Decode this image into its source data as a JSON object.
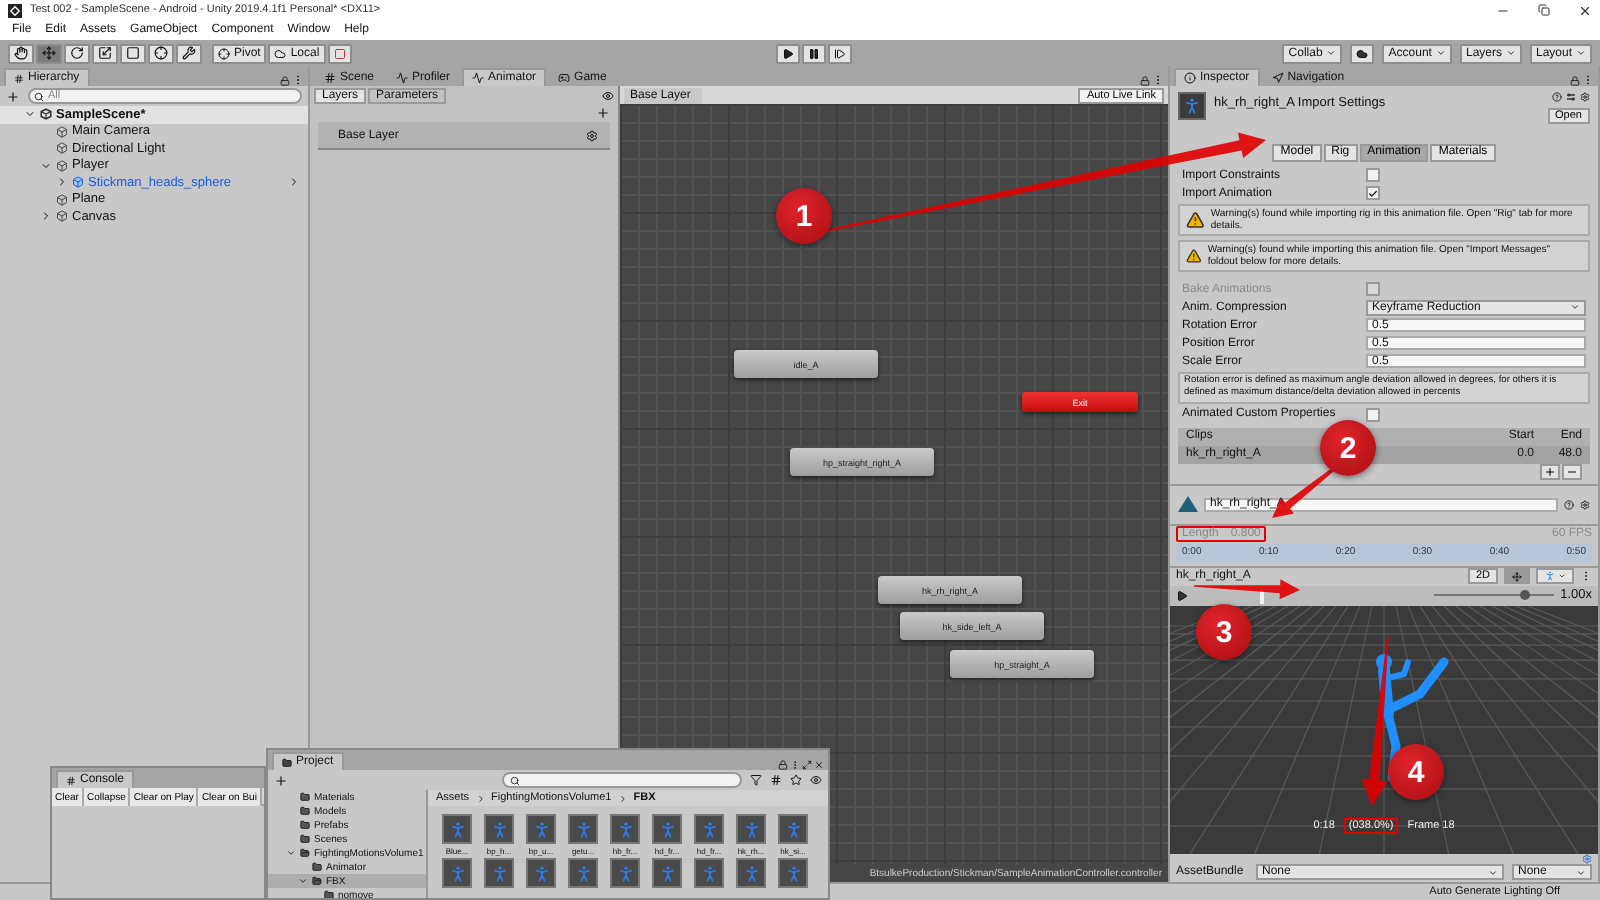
{
  "window": {
    "title": "Test 002 - SampleScene - Android - Unity 2019.4.1f1 Personal* <DX11>"
  },
  "menu": [
    "File",
    "Edit",
    "Assets",
    "GameObject",
    "Component",
    "Window",
    "Help"
  ],
  "toolbar": {
    "tools": [
      {
        "kind": "hand",
        "selected": false
      },
      {
        "kind": "move",
        "selected": true
      },
      {
        "kind": "rotate",
        "selected": false
      },
      {
        "kind": "scale",
        "selected": false
      },
      {
        "kind": "rect",
        "selected": false
      },
      {
        "kind": "transform",
        "selected": false
      },
      {
        "kind": "custom",
        "selected": false
      }
    ],
    "pivot": "Pivot",
    "space": "Local",
    "menus": [
      {
        "kind": "dropdown",
        "label": "Collab"
      },
      {
        "kind": "cloud"
      },
      {
        "kind": "dropdown",
        "label": "Account"
      },
      {
        "kind": "dropdown",
        "label": "Layers"
      },
      {
        "kind": "dropdown",
        "label": "Layout"
      }
    ]
  },
  "hierarchy": {
    "tab": "Hierarchy",
    "placeholder": "All",
    "tree": [
      {
        "label": "SampleScene*",
        "kind": "scene",
        "selected": true,
        "expanded": true,
        "children": [
          {
            "label": "Main Camera",
            "kind": "object",
            "selected": false
          },
          {
            "label": "Directional Light",
            "kind": "object",
            "selected": false
          },
          {
            "label": "Player",
            "kind": "object",
            "selected": false,
            "expanded": true,
            "children": [
              {
                "label": "Stickman_heads_sphere",
                "kind": "prefab",
                "selected": false,
                "expanded": false
              }
            ]
          },
          {
            "label": "Plane",
            "kind": "object",
            "selected": false
          },
          {
            "label": "Canvas",
            "kind": "object",
            "selected": false,
            "expanded": false
          }
        ]
      }
    ]
  },
  "animator": {
    "tabs": [
      {
        "label": "Scene",
        "kind": "scene",
        "selected": false
      },
      {
        "label": "Profiler",
        "kind": "profiler",
        "selected": false
      },
      {
        "label": "Animator",
        "kind": "animator",
        "selected": true
      },
      {
        "label": "Game",
        "kind": "game",
        "selected": false
      }
    ],
    "side_tabs": [
      {
        "label": "Layers",
        "selected": true
      },
      {
        "label": "Parameters",
        "selected": false
      }
    ],
    "layers": [
      "Base Layer"
    ],
    "breadcrumb": "Base Layer",
    "live_link": "Auto Live Link",
    "states": [
      {
        "label": "idle_A",
        "kind": "state"
      },
      {
        "label": "Exit",
        "kind": "exit"
      },
      {
        "label": "hp_straight_right_A",
        "kind": "state"
      },
      {
        "label": "hk_rh_right_A",
        "kind": "state"
      },
      {
        "label": "hk_side_left_A",
        "kind": "state"
      },
      {
        "label": "hp_straight_A",
        "kind": "state"
      }
    ],
    "path": "BtsulkeProduction/Stickman/SampleAnimationController.controller"
  },
  "inspector": {
    "tabs": [
      {
        "label": "Inspector",
        "kind": "info",
        "selected": true
      },
      {
        "label": "Navigation",
        "kind": "nav",
        "selected": false
      }
    ],
    "title": "hk_rh_right_A Import Settings",
    "open": "Open",
    "import_tabs": [
      {
        "label": "Model",
        "selected": false
      },
      {
        "label": "Rig",
        "selected": false
      },
      {
        "label": "Animation",
        "selected": true
      },
      {
        "label": "Materials",
        "selected": false
      }
    ],
    "options": [
      {
        "label": "Import Constraints",
        "checked": false
      },
      {
        "label": "Import Animation",
        "checked": true
      }
    ],
    "warnings": [
      "Warning(s) found while importing rig in this animation file. Open \"Rig\" tab for more details.",
      "Warning(s) found while importing this animation file. Open \"Import Messages\" foldout below for more details."
    ],
    "fields": [
      {
        "kind": "checkbox",
        "label": "Bake Animations",
        "checked": false,
        "disabled": true
      },
      {
        "kind": "dropdown",
        "label": "Anim. Compression",
        "value": "Keyframe Reduction"
      },
      {
        "kind": "text",
        "label": "Rotation Error",
        "value": "0.5"
      },
      {
        "kind": "text",
        "label": "Position Error",
        "value": "0.5"
      },
      {
        "kind": "text",
        "label": "Scale Error",
        "value": "0.5"
      }
    ],
    "help": "Rotation error is defined as maximum angle deviation allowed in degrees, for others it is defined as maximum distance/delta deviation allowed in percents",
    "custom_properties": {
      "label": "Animated Custom Properties",
      "checked": false
    },
    "clips": {
      "columns": [
        "Clips",
        "Start",
        "End"
      ],
      "rows": [
        {
          "name": "hk_rh_right_A",
          "start": "0.0",
          "end": "48.0",
          "selected": true
        }
      ]
    },
    "clip_name": "hk_rh_right_A",
    "length": {
      "label": "Length",
      "value": "0.800",
      "highlighted": true
    },
    "fps": "60 FPS",
    "ruler": [
      "0:00",
      "0:10",
      "0:20",
      "0:30",
      "0:40",
      "0:50"
    ],
    "preview": {
      "title": "hk_rh_right_A",
      "tools": [
        {
          "kind": "mode",
          "label": "2D",
          "selected": false
        },
        {
          "kind": "pivot",
          "selected": true
        },
        {
          "kind": "avatar",
          "selected": false
        }
      ],
      "scrub": {
        "level": 0.28
      },
      "speed": {
        "level": 0.75
      },
      "speed_label": "1.00x",
      "caption": [
        {
          "text": "0:18",
          "highlighted": false
        },
        {
          "text": "(038.0%)",
          "highlighted": true
        },
        {
          "text": "Frame 18",
          "highlighted": false
        }
      ]
    },
    "asset_bundle": {
      "label": "AssetBundle",
      "value": "None",
      "variant": "None"
    }
  },
  "console": {
    "tab": "Console",
    "buttons": [
      "Clear",
      "Collapse",
      "Clear on Play",
      "Clear on Bui"
    ]
  },
  "project": {
    "tab": "Project",
    "tree": [
      {
        "label": "Materials",
        "selected": false
      },
      {
        "label": "Models",
        "selected": false
      },
      {
        "label": "Prefabs",
        "selected": false
      },
      {
        "label": "Scenes",
        "selected": false
      },
      {
        "label": "FightingMotionsVolume1",
        "expanded": true,
        "selected": false,
        "children": [
          {
            "label": "Animator",
            "selected": false
          },
          {
            "label": "FBX",
            "expanded": true,
            "selected": true,
            "children": [
              {
                "label": "nomove",
                "selected": false
              }
            ]
          }
        ]
      }
    ],
    "breadcrumb": [
      "Assets",
      "FightingMotionsVolume1",
      "FBX"
    ],
    "assets": [
      "Blue...",
      "bp_h...",
      "bp_u...",
      "getu...",
      "hb_fr...",
      "hd_fr...",
      "hd_fr...",
      "hk_rh...",
      "hk_si..."
    ]
  },
  "status_bar": {
    "text": "Auto Generate Lighting Off"
  },
  "annotations": [
    {
      "label": "1"
    },
    {
      "label": "2"
    },
    {
      "label": "3"
    },
    {
      "label": "4"
    }
  ]
}
